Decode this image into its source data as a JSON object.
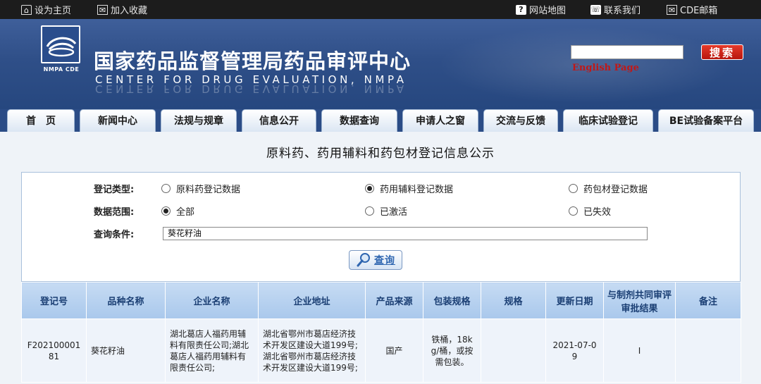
{
  "topbar": {
    "set_home": "设为主页",
    "add_favorite": "加入收藏",
    "site_map": "网站地图",
    "contact_us": "联系我们",
    "mailbox": "CDE邮箱"
  },
  "header": {
    "title": "国家药品监督管理局药品审评中心",
    "subtitle": "CENTER FOR DRUG EVALUATION, NMPA",
    "logo_text": "NMPA CDE",
    "search_button": "搜索",
    "search_value": "",
    "english_link": "English Page"
  },
  "nav": {
    "tabs": [
      {
        "label": "首　页"
      },
      {
        "label": "新闻中心"
      },
      {
        "label": "法规与规章"
      },
      {
        "label": "信息公开"
      },
      {
        "label": "数据查询"
      },
      {
        "label": "申请人之窗"
      },
      {
        "label": "交流与反馈"
      },
      {
        "label": "临床试验登记"
      },
      {
        "label": "BE试验备案平台"
      }
    ]
  },
  "page": {
    "title": "原料药、药用辅料和药包材登记信息公示"
  },
  "filter": {
    "type_label": "登记类型:",
    "type_options": [
      {
        "label": "原料药登记数据",
        "selected": false
      },
      {
        "label": "药用辅料登记数据",
        "selected": true
      },
      {
        "label": "药包材登记数据",
        "selected": false
      }
    ],
    "scope_label": "数据范围:",
    "scope_options": [
      {
        "label": "全部",
        "selected": true
      },
      {
        "label": "已激活",
        "selected": false
      },
      {
        "label": "已失效",
        "selected": false
      }
    ],
    "query_label": "查询条件:",
    "query_value": "葵花籽油",
    "query_button": "查询"
  },
  "table": {
    "headers": [
      "登记号",
      "品种名称",
      "企业名称",
      "企业地址",
      "产品来源",
      "包装规格",
      "规格",
      "更新日期",
      "与制剂共同审评审批结果",
      "备注"
    ],
    "rows": [
      {
        "reg_no": "F20210000181",
        "name": "葵花籽油",
        "company": "湖北葛店人福药用辅料有限责任公司;湖北葛店人福药用辅料有限责任公司;",
        "address": "湖北省鄂州市葛店经济技术开发区建设大道199号;湖北省鄂州市葛店经济技术开发区建设大道199号;",
        "source": "国产",
        "packaging": "铁桶，18kg/桶，或按需包装。",
        "spec": "",
        "updated": "2021-07-09",
        "result": "I",
        "remark": ""
      }
    ]
  }
}
